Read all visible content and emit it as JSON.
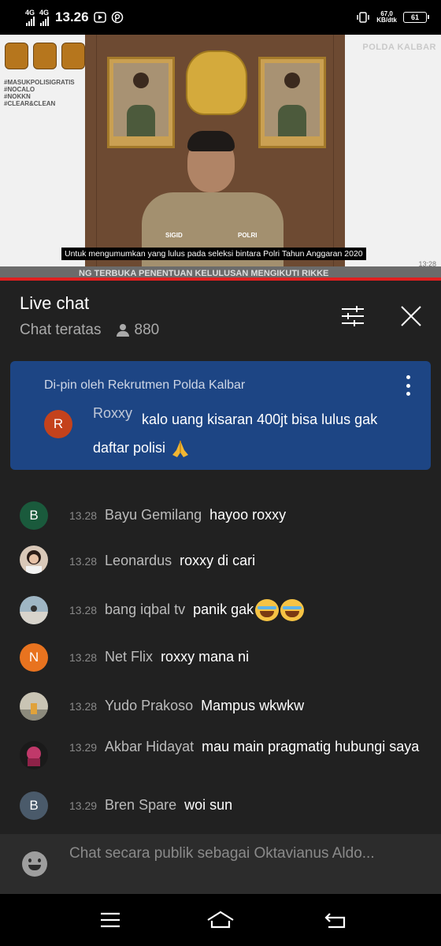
{
  "status_bar": {
    "network_1": "4G",
    "network_2": "4G",
    "time": "13.26",
    "speed_value": "67,0",
    "speed_unit": "KB/dtk",
    "battery": "61"
  },
  "video": {
    "hashtags": [
      "#MASUKPOLISIGRATIS",
      "#NOCALO",
      "#NOKKN",
      "#CLEAR&CLEAN"
    ],
    "channel_watermark": "POLDA KALBAR",
    "subtitle": "Untuk mengumumkan yang lulus pada seleksi bintara Polri Tahun Anggaran 2020",
    "ticker": "NG TERBUKA PENENTUAN KELULUSAN MENGIKUTI RIKKE",
    "timestamp": "13:28",
    "officer_name_tag": "SIGID",
    "uniform_tag": "POLRI"
  },
  "chat": {
    "title": "Live chat",
    "mode": "Chat teratas",
    "viewer_count": "880",
    "pinned": {
      "pinned_by": "Di-pin oleh Rekrutmen Polda Kalbar",
      "avatar_letter": "R",
      "author": "Roxxy",
      "text": "kalo uang kisaran 400jt bisa lulus gak daftar polisi"
    },
    "messages": [
      {
        "avatar": "B",
        "avatar_color": "#1a5a3c",
        "time": "13.28",
        "author": "Bayu Gemilang",
        "text": "hayoo roxxy"
      },
      {
        "avatar": "",
        "avatar_color": "#d9c8b8",
        "time": "13.28",
        "author": "Leonardus",
        "text": "roxxy di cari"
      },
      {
        "avatar": "",
        "avatar_color": "#9fb6c4",
        "time": "13.28",
        "author": "bang iqbal tv",
        "text": "panik gak"
      },
      {
        "avatar": "N",
        "avatar_color": "#e8731f",
        "time": "13.28",
        "author": "Net Flix",
        "text": "roxxy mana ni"
      },
      {
        "avatar": "",
        "avatar_color": "#c9c4b4",
        "time": "13.28",
        "author": "Yudo Prakoso",
        "text": "Mampus wkwkw"
      },
      {
        "avatar": "",
        "avatar_color": "#1a1a1a",
        "time": "13.29",
        "author": "Akbar Hidayat",
        "text": "mau main pragmatig hubungi saya"
      },
      {
        "avatar": "B",
        "avatar_color": "#4a5a6a",
        "time": "13.29",
        "author": "Bren Spare",
        "text": "woi sun"
      }
    ],
    "input_placeholder": "Chat secara publik sebagai Oktavianus Aldo..."
  },
  "icons": {
    "filter": "sliders-icon",
    "close": "close-icon",
    "more": "more-vertical-icon",
    "emoji": "emoji-icon",
    "nav_menu": "menu-icon",
    "nav_home": "home-icon",
    "nav_back": "back-icon"
  }
}
